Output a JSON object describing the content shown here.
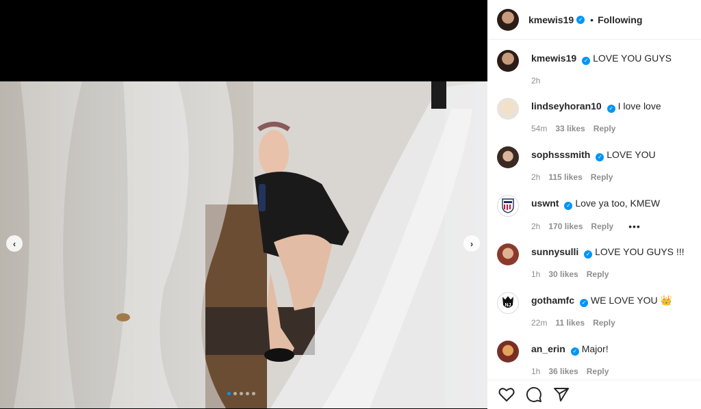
{
  "post": {
    "author": "kmewis19",
    "follow_status": "Following",
    "separator": "•",
    "carousel": {
      "slide_count": 5,
      "active_index": 0
    }
  },
  "colors": {
    "verified": "#0095f6",
    "meta": "#8e8e8e",
    "text": "#262626"
  },
  "comments": [
    {
      "user": "kmewis19",
      "text": "LOVE YOU GUYS",
      "time": "2h",
      "likes": "",
      "reply": ""
    },
    {
      "user": "lindseyhoran10",
      "text": "I love love",
      "time": "54m",
      "likes": "33 likes",
      "reply": "Reply"
    },
    {
      "user": "sophsssmith",
      "text": "LOVE YOU",
      "time": "2h",
      "likes": "115 likes",
      "reply": "Reply"
    },
    {
      "user": "uswnt",
      "text": "Love ya too, KMEW",
      "time": "2h",
      "likes": "170 likes",
      "reply": "Reply",
      "more": "•••"
    },
    {
      "user": "sunnysulli",
      "text": "LOVE YOU GUYS !!!",
      "time": "1h",
      "likes": "30 likes",
      "reply": "Reply"
    },
    {
      "user": "gothamfc",
      "text": "WE LOVE YOU 👑",
      "time": "22m",
      "likes": "11 likes",
      "reply": "Reply"
    },
    {
      "user": "an_erin",
      "text": "Major!",
      "time": "1h",
      "likes": "36 likes",
      "reply": "Reply"
    }
  ],
  "icons": [
    "heart-icon",
    "comment-icon",
    "share-icon",
    "verified-badge-icon",
    "chevron-left-icon",
    "chevron-right-icon"
  ]
}
